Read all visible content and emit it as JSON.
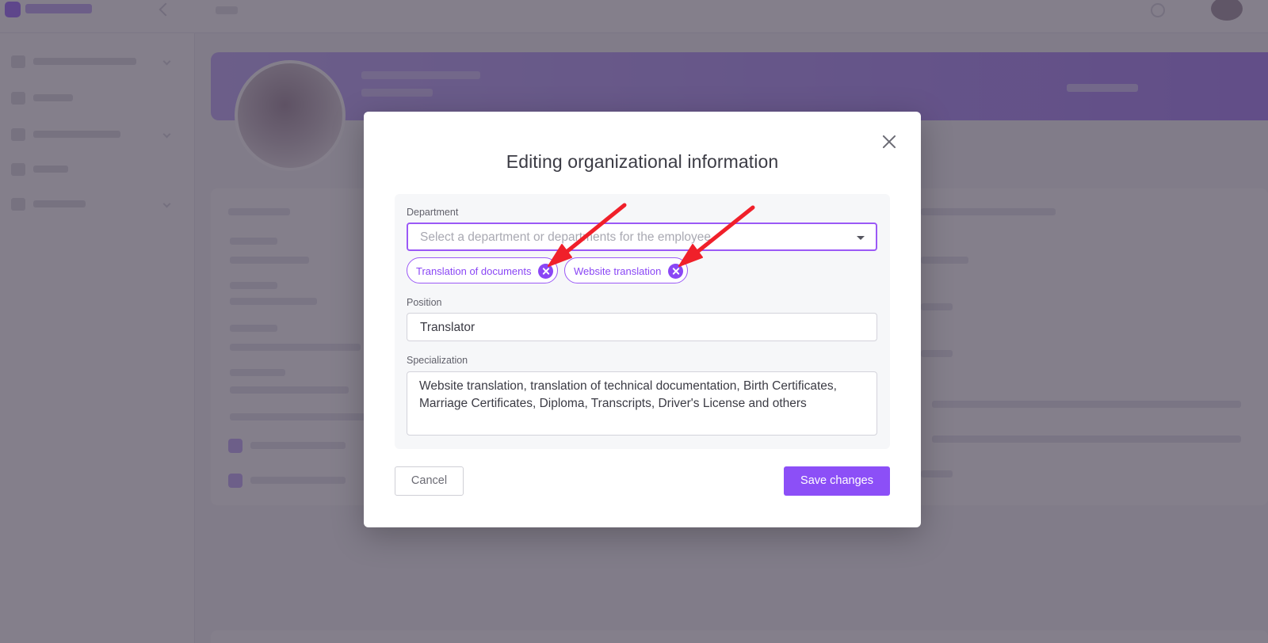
{
  "modal": {
    "title": "Editing organizational information",
    "department": {
      "label": "Department",
      "placeholder": "Select a department or departments for the employee",
      "chips": [
        {
          "label": "Translation of documents"
        },
        {
          "label": "Website translation"
        }
      ]
    },
    "position": {
      "label": "Position",
      "value": "Translator"
    },
    "specialization": {
      "label": "Specialization",
      "value": "Website translation, translation of technical documentation, Birth Certificates, Marriage Certificates, Diploma, Transcripts, Driver's License and others"
    },
    "buttons": {
      "cancel": "Cancel",
      "save": "Save changes"
    }
  },
  "colors": {
    "accent": "#8c4ff7",
    "annotation_arrow": "#f0202a",
    "overlay": "#4a4254"
  },
  "icons": [
    "close-icon",
    "chevron-down-icon",
    "remove-chip-icon",
    "annotation-arrow"
  ]
}
